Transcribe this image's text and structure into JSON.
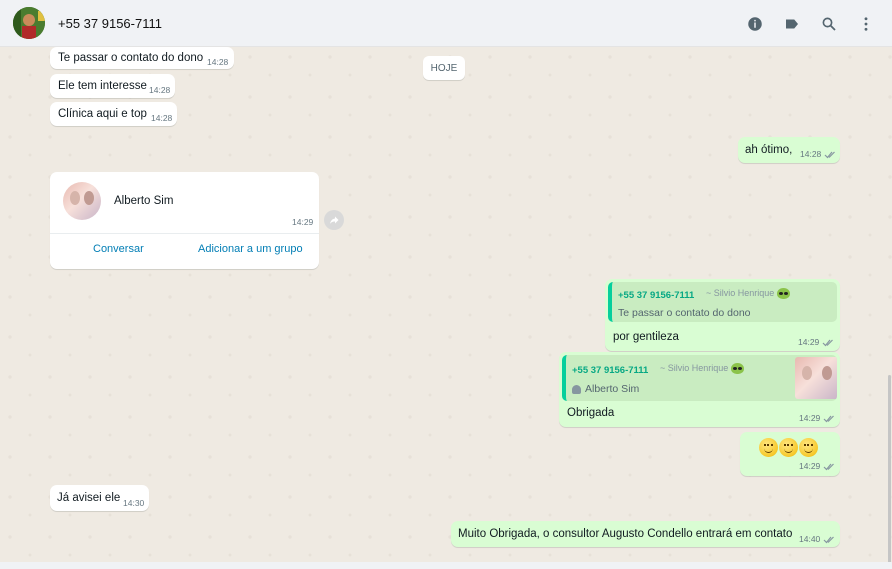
{
  "header": {
    "contact_name": "+55 37 9156-7111",
    "icons": [
      "info-icon",
      "label-icon",
      "search-icon",
      "menu-icon"
    ]
  },
  "date_chip": "HOJE",
  "messages": [
    {
      "text": "Te passar o contato do dono",
      "time": "14:28"
    },
    {
      "text": "Ele tem interesse",
      "time": "14:28"
    },
    {
      "text": "Clínica aqui e top",
      "time": "14:28"
    },
    {
      "text": "ah ótimo,",
      "time": "14:28"
    },
    {
      "text": "Já avisei ele",
      "time": "14:30"
    },
    {
      "text": "Muito Obrigada, o consultor Augusto Condello entrará em contato",
      "time": "14:40"
    }
  ],
  "contact_card": {
    "name": "Alberto Sim",
    "time": "14:29",
    "action_chat": "Conversar",
    "action_group": "Adicionar a um grupo"
  },
  "reply1": {
    "quote_author": "+55 37 9156-7111",
    "quote_sub": "~ Silvio Henrique",
    "quote_text": "Te passar o contato do dono",
    "text": "por gentileza",
    "time": "14:29"
  },
  "reply2": {
    "quote_author": "+55 37 9156-7111",
    "quote_sub": "~ Silvio Henrique",
    "quote_text": "Alberto  Sim",
    "text": "Obrigada",
    "time": "14:29"
  },
  "emoji_msg": {
    "emoji": "😊😊😊",
    "time": "14:29"
  },
  "colors": {
    "outgoing": "#d9fdd3",
    "incoming": "#ffffff",
    "accent": "#06cf9c",
    "link": "#027eb5"
  }
}
